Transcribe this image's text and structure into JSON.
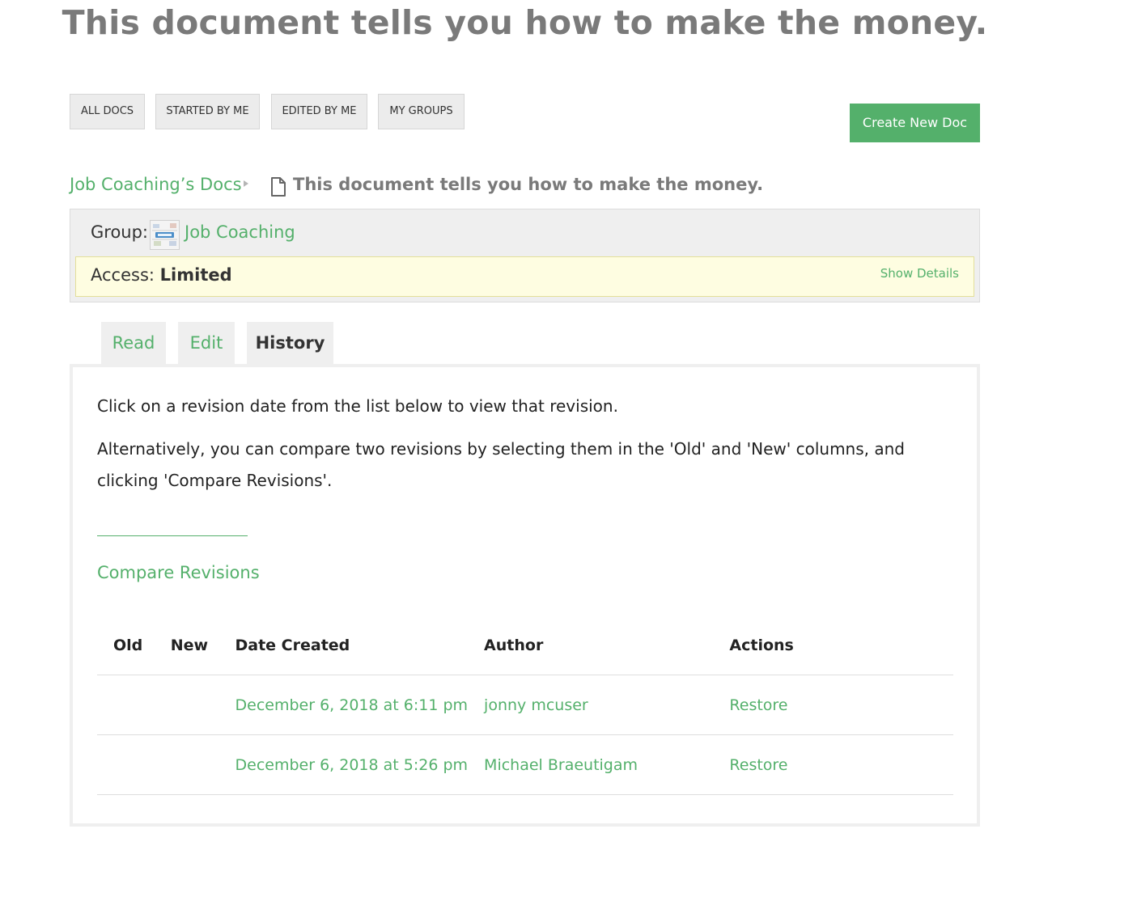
{
  "page": {
    "title": "This document tells you how to make the money."
  },
  "filters": [
    {
      "label": "ALL DOCS"
    },
    {
      "label": "STARTED BY ME"
    },
    {
      "label": "EDITED BY ME"
    },
    {
      "label": "MY GROUPS"
    }
  ],
  "create_button": {
    "label": "Create New Doc"
  },
  "breadcrumb": {
    "parent": "Job Coaching’s Docs",
    "current": "This document tells you how to make the money."
  },
  "group": {
    "label": "Group:",
    "name": "Job Coaching",
    "access_label": "Access:",
    "access_value": "Limited",
    "show_details": "Show Details"
  },
  "tabs": [
    {
      "label": "Read"
    },
    {
      "label": "Edit"
    },
    {
      "label": "History",
      "active": true
    }
  ],
  "history": {
    "intro_1": "Click on a revision date from the list below to view that revision.",
    "intro_2": "Alternatively, you can compare two revisions by selecting them in the 'Old' and 'New' columns, and clicking 'Compare Revisions'.",
    "compare_button": "Compare Revisions",
    "columns": {
      "old": "Old",
      "new": "New",
      "date": "Date Created",
      "author": "Author",
      "actions": "Actions"
    },
    "rows": [
      {
        "date": "December 6, 2018 at 6:11 pm",
        "author": "jonny mcuser",
        "action": "Restore"
      },
      {
        "date": "December 6, 2018 at 5:26 pm",
        "author": "Michael Braeutigam",
        "action": "Restore"
      }
    ]
  },
  "colors": {
    "accent": "#54b06b",
    "title": "#7a7a7a",
    "panel": "#efefef",
    "access_bg": "#fefde1"
  }
}
